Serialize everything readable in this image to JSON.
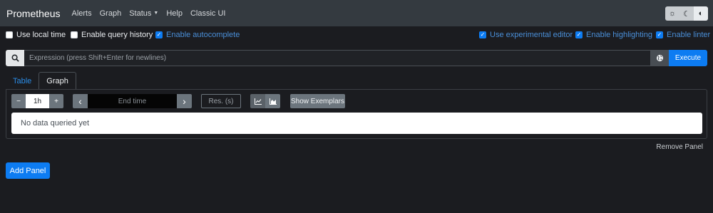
{
  "navbar": {
    "brand": "Prometheus",
    "links": [
      "Alerts",
      "Graph",
      "Status",
      "Help",
      "Classic UI"
    ],
    "theme_icons": [
      "sun-icon",
      "moon-icon",
      "half-circle-icon"
    ]
  },
  "options": {
    "use_local_time": {
      "label": "Use local time",
      "checked": false
    },
    "enable_query_history": {
      "label": "Enable query history",
      "checked": false
    },
    "enable_autocomplete": {
      "label": "Enable autocomplete",
      "checked": true
    },
    "use_experimental_editor": {
      "label": "Use experimental editor",
      "checked": true
    },
    "enable_highlighting": {
      "label": "Enable highlighting",
      "checked": true
    },
    "enable_linter": {
      "label": "Enable linter",
      "checked": true
    }
  },
  "query": {
    "placeholder": "Expression (press Shift+Enter for newlines)",
    "execute_label": "Execute"
  },
  "tabs": {
    "table": "Table",
    "graph": "Graph",
    "active": "Graph"
  },
  "graph_controls": {
    "decrease_label": "−",
    "range": "1h",
    "increase_label": "+",
    "prev_label": "‹",
    "end_time_placeholder": "End time",
    "next_label": "›",
    "resolution_placeholder": "Res. (s)",
    "show_exemplars_label": "Show Exemplars"
  },
  "result": {
    "message": "No data queried yet"
  },
  "panel_actions": {
    "remove_panel": "Remove Panel",
    "add_panel": "Add Panel"
  },
  "colors": {
    "accent": "#0d7cf2",
    "navbar": "#343a40",
    "background": "#1b1c20"
  }
}
